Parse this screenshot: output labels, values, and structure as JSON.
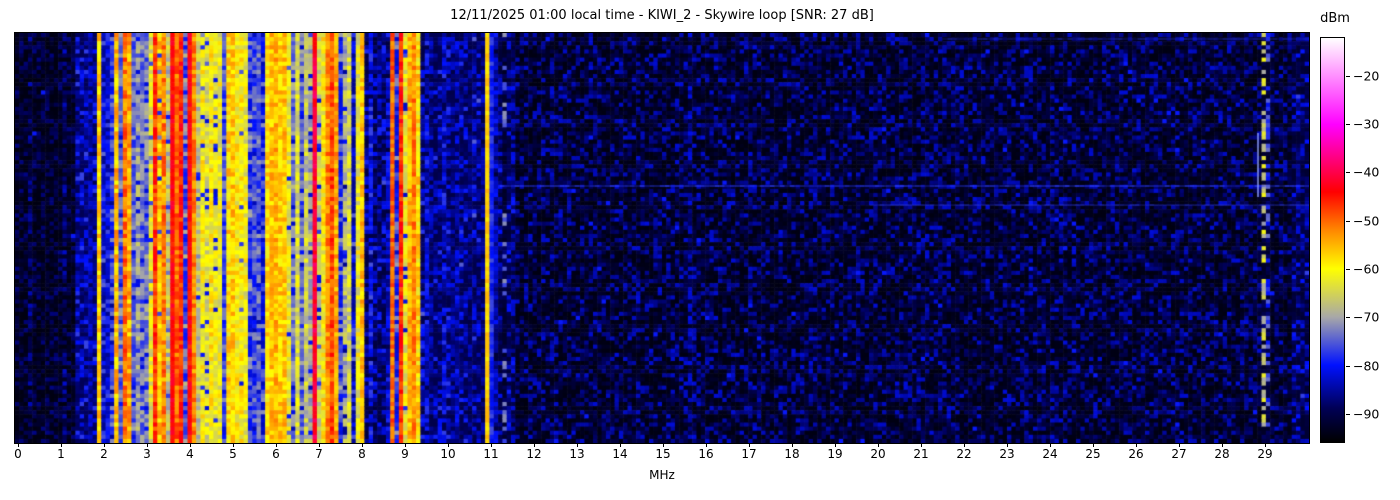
{
  "title": "12/11/2025 01:00 local time - KIWI_2 - Skywire loop [SNR: 27 dB]",
  "x_axis": {
    "label": "MHz",
    "min": 0,
    "max": 30,
    "ticks": [
      "0",
      "1",
      "2",
      "3",
      "4",
      "5",
      "6",
      "7",
      "8",
      "9",
      "10",
      "11",
      "12",
      "13",
      "14",
      "15",
      "16",
      "17",
      "18",
      "19",
      "20",
      "21",
      "22",
      "23",
      "24",
      "25",
      "26",
      "27",
      "28",
      "29"
    ]
  },
  "colorbar": {
    "label": "dBm",
    "vmax": -12,
    "vmin": -96,
    "ticks": [
      {
        "value": -20,
        "label": "−20"
      },
      {
        "value": -30,
        "label": "−30"
      },
      {
        "value": -40,
        "label": "−40"
      },
      {
        "value": -50,
        "label": "−50"
      },
      {
        "value": -60,
        "label": "−60"
      },
      {
        "value": -70,
        "label": "−70"
      },
      {
        "value": -80,
        "label": "−80"
      },
      {
        "value": -90,
        "label": "−90"
      }
    ]
  },
  "chart_data": {
    "type": "heatmap",
    "subtype": "radio-spectrogram-waterfall",
    "title": "12/11/2025 01:00 local time - KIWI_2 - Skywire loop [SNR: 27 dB]",
    "xlabel": "MHz",
    "x_range": [
      0,
      30
    ],
    "value_label": "dBm",
    "value_range": [
      -96,
      -12
    ],
    "grid": {
      "cols": 300,
      "rows": 100
    },
    "seed": 1337,
    "colormap": [
      [
        -96,
        "#000000"
      ],
      [
        -89,
        "#000055"
      ],
      [
        -80,
        "#0011ff"
      ],
      [
        -70,
        "#a8a8a8"
      ],
      [
        -60,
        "#ffff00"
      ],
      [
        -52,
        "#ff8800"
      ],
      [
        -44,
        "#ff0000"
      ],
      [
        -30,
        "#ff00ff"
      ],
      [
        -12,
        "#ffffff"
      ]
    ],
    "default_band": {
      "bg": -94.5,
      "act": 0.008,
      "pmin": -89,
      "pmax": -86,
      "spread": 12.5
    },
    "bands": [
      {
        "f0": 0.0,
        "f1": 1.35,
        "bg": -94.5,
        "act": 0.05,
        "pmin": -88,
        "pmax": -84,
        "spread": 8,
        "drop": 0.4
      },
      {
        "f0": 1.35,
        "f1": 1.92,
        "bg": -89,
        "act": 0.55,
        "pmin": -84,
        "pmax": -75,
        "drop": 0.3,
        "cv": 7
      },
      {
        "f0": 1.92,
        "f1": 2.28,
        "bg": -86,
        "act": 0.6,
        "pmin": -82,
        "pmax": -66,
        "drop": 0.25
      },
      {
        "f0": 2.28,
        "f1": 2.75,
        "bg": -82,
        "act": 0.8,
        "pmin": -78,
        "pmax": -56,
        "skew": 1.1
      },
      {
        "f0": 2.75,
        "f1": 3.05,
        "bg": -82,
        "act": 0.7,
        "pmin": -80,
        "pmax": -64
      },
      {
        "f0": 3.05,
        "f1": 4.3,
        "bg": -80,
        "act": 0.85,
        "pmin": -75,
        "pmax": -54,
        "skew": 0.9,
        "drop": 0.08
      },
      {
        "f0": 4.3,
        "f1": 4.95,
        "bg": -82,
        "act": 0.72,
        "pmin": -79,
        "pmax": -62,
        "skew": 1.2
      },
      {
        "f0": 4.95,
        "f1": 5.4,
        "bg": -82,
        "act": 0.75,
        "pmin": -77,
        "pmax": -59,
        "skew": 1.1
      },
      {
        "f0": 5.4,
        "f1": 5.78,
        "bg": -84,
        "act": 0.65,
        "pmin": -80,
        "pmax": -63
      },
      {
        "f0": 5.78,
        "f1": 6.32,
        "bg": -80,
        "act": 0.85,
        "pmin": -72,
        "pmax": -56,
        "skew": 0.9
      },
      {
        "f0": 6.32,
        "f1": 6.9,
        "bg": -84,
        "act": 0.65,
        "pmin": -81,
        "pmax": -65
      },
      {
        "f0": 6.9,
        "f1": 7.52,
        "bg": -82,
        "act": 0.75,
        "pmin": -78,
        "pmax": -56,
        "skew": 1.1
      },
      {
        "f0": 7.52,
        "f1": 8.06,
        "bg": -86,
        "act": 0.55,
        "pmin": -81,
        "pmax": -64
      },
      {
        "f0": 8.06,
        "f1": 8.62,
        "bg": -91,
        "act": 0.18,
        "pmin": -86,
        "pmax": -79
      },
      {
        "f0": 8.62,
        "f1": 9.38,
        "bg": -83,
        "act": 0.8,
        "pmin": -78,
        "pmax": -55,
        "skew": 1.0
      },
      {
        "f0": 9.38,
        "f1": 10.86,
        "bg": -90,
        "act": 0.35,
        "pmin": -87,
        "pmax": -81,
        "drop": 0.3
      },
      {
        "f0": 10.94,
        "f1": 11.6,
        "bg": -91.5,
        "act": 0.28,
        "pmin": -88,
        "pmax": -83
      },
      {
        "f0": 29.6,
        "f1": 30.0,
        "bg": -92,
        "act": 0.35,
        "pmin": -88,
        "pmax": -84
      }
    ],
    "carriers": [
      {
        "f": 1.88,
        "p": -57,
        "v": 4
      },
      {
        "f": 2.33,
        "p": -56,
        "v": 5
      },
      {
        "f": 2.44,
        "p": -51,
        "v": 5
      },
      {
        "f": 2.57,
        "p": -55,
        "v": 5
      },
      {
        "f": 3.22,
        "p": -47,
        "v": 4
      },
      {
        "f": 3.4,
        "p": -52,
        "v": 5
      },
      {
        "f": 3.56,
        "p": -44,
        "v": 3
      },
      {
        "f": 3.68,
        "p": -50,
        "v": 4
      },
      {
        "f": 3.81,
        "p": -46,
        "v": 4
      },
      {
        "f": 3.95,
        "p": -44,
        "v": 3
      },
      {
        "f": 4.08,
        "p": -52,
        "v": 4
      },
      {
        "f": 4.47,
        "p": -60,
        "v": 5
      },
      {
        "f": 4.66,
        "p": -62,
        "v": 5
      },
      {
        "f": 4.85,
        "p": -58,
        "v": 5
      },
      {
        "f": 5.01,
        "p": -57,
        "v": 5
      },
      {
        "f": 5.12,
        "p": -60,
        "v": 5
      },
      {
        "f": 5.28,
        "p": -62,
        "v": 5
      },
      {
        "f": 5.8,
        "p": -58,
        "v": 4
      },
      {
        "f": 5.91,
        "p": -56,
        "v": 4
      },
      {
        "f": 6.0,
        "p": -55,
        "v": 4
      },
      {
        "f": 6.12,
        "p": -57,
        "v": 4
      },
      {
        "f": 6.22,
        "p": -56,
        "v": 4
      },
      {
        "f": 6.5,
        "p": -64,
        "v": 5
      },
      {
        "f": 6.68,
        "p": -66,
        "v": 5
      },
      {
        "f": 6.95,
        "p": -41,
        "v": 3
      },
      {
        "f": 7.1,
        "p": -60,
        "v": 5
      },
      {
        "f": 7.22,
        "p": -52,
        "v": 4
      },
      {
        "f": 7.31,
        "p": -48,
        "v": 4
      },
      {
        "f": 7.44,
        "p": -54,
        "v": 4
      },
      {
        "f": 7.7,
        "p": -65,
        "v": 5
      },
      {
        "f": 7.86,
        "p": -62,
        "v": 5
      },
      {
        "f": 7.98,
        "p": -56,
        "v": 4
      },
      {
        "f": 8.73,
        "p": -50,
        "v": 4
      },
      {
        "f": 8.9,
        "p": -46,
        "v": 4
      },
      {
        "f": 9.06,
        "p": -55,
        "v": 4
      },
      {
        "f": 9.19,
        "p": -52,
        "v": 4
      },
      {
        "f": 9.3,
        "p": -58,
        "v": 5
      },
      {
        "f": 10.9,
        "p": -57,
        "v": 2
      },
      {
        "f": 11.02,
        "p": -79,
        "v": 3
      },
      {
        "f": 11.28,
        "p": -74,
        "v": 3,
        "gap": 0.75
      },
      {
        "f": 15.62,
        "p": -84,
        "v": 3,
        "gap": 0.55
      },
      {
        "f": 28.95,
        "p": -66,
        "v": 5,
        "gap": 0.5
      },
      {
        "f": 29.12,
        "p": -77,
        "v": 4,
        "gap": 0.45
      }
    ],
    "streaks": [
      {
        "y": 152,
        "f0": 11.2,
        "f1": 30.0,
        "color": "#2b3cff",
        "alpha": 0.5
      },
      {
        "y": 171,
        "f0": 19.8,
        "f1": 30.0,
        "color": "#2330cc",
        "alpha": 0.4
      },
      {
        "y": 5,
        "f0": 21.5,
        "f1": 30.0,
        "color": "#2330cc",
        "alpha": 0.38
      }
    ],
    "vsegments": [
      {
        "f": 28.82,
        "y0": 100,
        "y1": 164,
        "color": "#93a4ff"
      }
    ]
  }
}
